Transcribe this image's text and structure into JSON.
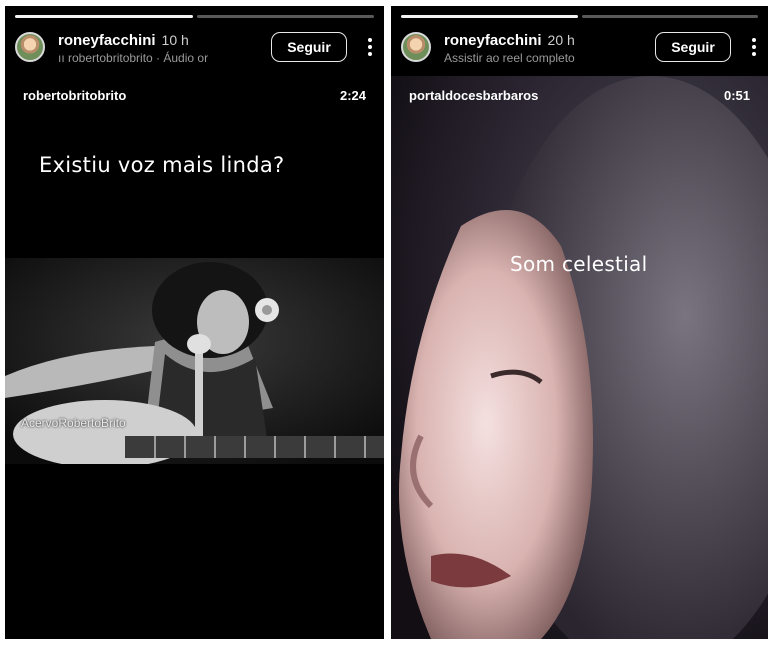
{
  "left_story": {
    "username": "roneyfacchini",
    "time": "10 h",
    "subline": "ıı robertobritobrito · Áudio or",
    "follow_label": "Seguir",
    "reel_author": "robertobritobrito",
    "reel_duration": "2:24",
    "caption": "Existiu voz mais  linda?",
    "watermark": "AcervoRobertoBrito"
  },
  "right_story": {
    "username": "roneyfacchini",
    "time": "20 h",
    "subline": "Assistir ao reel completo",
    "follow_label": "Seguir",
    "reel_author": "portaldocesbarbaros",
    "reel_duration": "0:51",
    "caption": "Som celestial"
  },
  "colors": {
    "background": "#000000",
    "text": "#ffffff",
    "progress_done": "#f2f2f2"
  }
}
